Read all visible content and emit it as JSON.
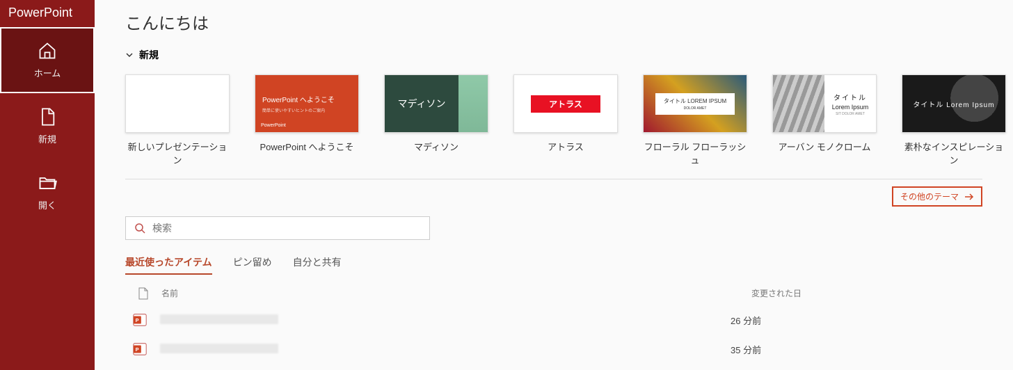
{
  "app_name": "PowerPoint",
  "nav": {
    "home": "ホーム",
    "new": "新規",
    "open": "開く"
  },
  "greeting": "こんにちは",
  "section_new": "新規",
  "templates": [
    {
      "label": "新しいプレゼンテーション"
    },
    {
      "label": "PowerPoint へようこそ",
      "thumb_title": "PowerPoint へようこそ",
      "thumb_sub": "簡単に使いやすいヒントのご案内",
      "thumb_logo": "PowerPoint"
    },
    {
      "label": "マディソン",
      "thumb_text": "マディソン"
    },
    {
      "label": "アトラス",
      "thumb_text": "アトラス"
    },
    {
      "label": "フローラル フローラッシュ",
      "thumb_title": "タイトル LOREM IPSUM",
      "thumb_sub": "DOLOR AMET"
    },
    {
      "label": "アーバン モノクローム",
      "thumb_t1": "タイトル",
      "thumb_t2": "Lorem Ipsum",
      "thumb_t3": "SIT DOLOR AMET"
    },
    {
      "label": "素朴なインスピレーション",
      "thumb_text": "タイトル Lorem Ipsum"
    }
  ],
  "more_themes": "その他のテーマ",
  "search_placeholder": "検索",
  "tabs": {
    "recent": "最近使ったアイテム",
    "pinned": "ピン留め",
    "shared": "自分と共有"
  },
  "list": {
    "col_name": "名前",
    "col_modified": "変更された日",
    "rows": [
      {
        "modified": "26 分前"
      },
      {
        "modified": "35 分前"
      }
    ]
  }
}
